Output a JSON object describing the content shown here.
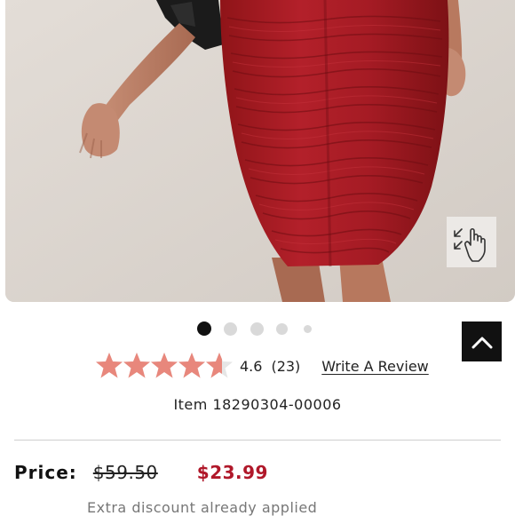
{
  "product": {
    "image_alt": "Red ruched bodycon skirt on model",
    "zoom_icon": "tap-zoom-icon",
    "gallery": {
      "count": 5,
      "active_index": 0
    },
    "rating": {
      "value": "4.6",
      "count": "(23)",
      "stars_fraction": 0.92,
      "star_color": "#e8877c"
    },
    "write_review_label": "Write A Review",
    "item_label": "Item 18290304-00006",
    "price": {
      "label": "Price:",
      "original": "$59.50",
      "sale": "$23.99",
      "sale_color": "#b0182a"
    },
    "discount_note": "Extra discount already applied"
  },
  "controls": {
    "back_to_top_icon": "chevron-up-icon"
  }
}
